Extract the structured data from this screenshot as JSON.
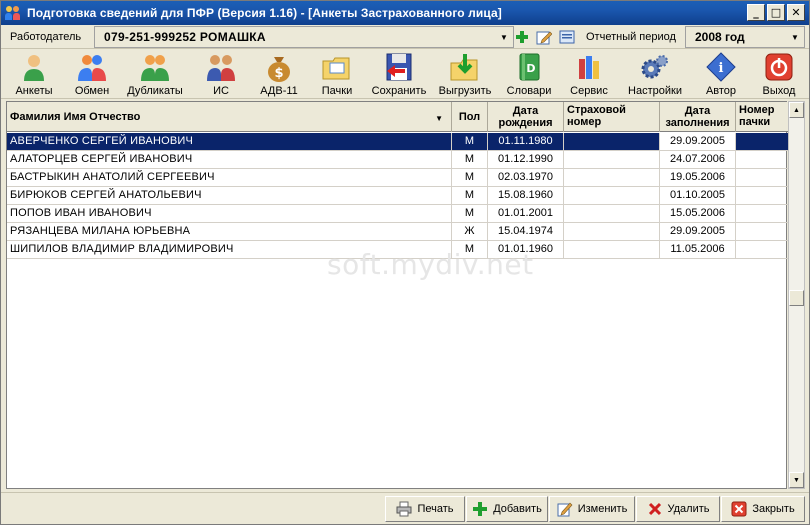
{
  "window": {
    "title": "Подготовка сведений для ПФР (Версия 1.16) - [Анкеты Застрахованного лица]"
  },
  "employer": {
    "label": "Работодатель",
    "value": "079-251-999252 РОМАШКА"
  },
  "period": {
    "label": "Отчетный период",
    "value": "2008 год"
  },
  "toolbar": {
    "ankety": "Анкеты",
    "obmen": "Обмен",
    "dublikaty": "Дубликаты",
    "is": "ИС",
    "adv11": "АДВ-11",
    "pachki": "Пачки",
    "sohranit": "Сохранить",
    "vygruzit": "Выгрузить",
    "slovari": "Словари",
    "servis": "Сервис",
    "nastroyki": "Настройки",
    "avtor": "Автор",
    "vyhod": "Выход"
  },
  "table": {
    "headers": {
      "name": "Фамилия Имя Отчество",
      "sex": "Пол",
      "dob_1": "Дата",
      "dob_2": "рождения",
      "ins_1": "Страховой",
      "ins_2": "номер",
      "fill_1": "Дата",
      "fill_2": "заполнения",
      "pack_1": "Номер",
      "pack_2": "пачки"
    },
    "rows": [
      {
        "name": "АВЕРЧЕНКО СЕРГЕЙ ИВАНОВИЧ",
        "sex": "М",
        "dob": "01.11.1980",
        "ins": "",
        "filled": "29.09.2005",
        "pack": ""
      },
      {
        "name": "АЛАТОРЦЕВ СЕРГЕЙ ИВАНОВИЧ",
        "sex": "М",
        "dob": "01.12.1990",
        "ins": "",
        "filled": "24.07.2006",
        "pack": ""
      },
      {
        "name": "БАСТРЫКИН АНАТОЛИЙ СЕРГЕЕВИЧ",
        "sex": "М",
        "dob": "02.03.1970",
        "ins": "",
        "filled": "19.05.2006",
        "pack": ""
      },
      {
        "name": "БИРЮКОВ СЕРГЕЙ АНАТОЛЬЕВИЧ",
        "sex": "М",
        "dob": "15.08.1960",
        "ins": "",
        "filled": "01.10.2005",
        "pack": ""
      },
      {
        "name": "ПОПОВ ИВАН ИВАНОВИЧ",
        "sex": "М",
        "dob": "01.01.2001",
        "ins": "",
        "filled": "15.05.2006",
        "pack": ""
      },
      {
        "name": "РЯЗАНЦЕВА МИЛАНА ЮРЬЕВНА",
        "sex": "Ж",
        "dob": "15.04.1974",
        "ins": "",
        "filled": "29.09.2005",
        "pack": ""
      },
      {
        "name": "ШИПИЛОВ ВЛАДИМИР ВЛАДИМИРОВИЧ",
        "sex": "М",
        "dob": "01.01.1960",
        "ins": "",
        "filled": "11.05.2006",
        "pack": ""
      }
    ]
  },
  "watermark": "soft.mydiv.net",
  "bottom": {
    "print": "Печать",
    "add": "Добавить",
    "edit": "Изменить",
    "delete": "Удалить",
    "close": "Закрыть"
  },
  "colors": {
    "selection": "#0a246a",
    "titlebar": "#1a56ad"
  }
}
